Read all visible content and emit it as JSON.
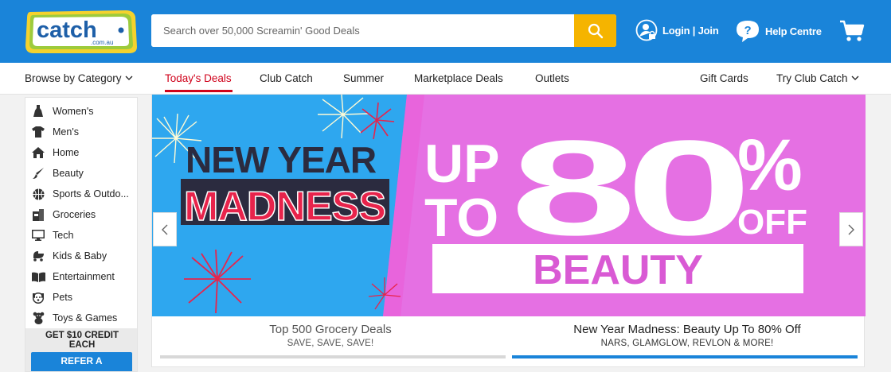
{
  "header": {
    "logo_text": "catch",
    "logo_sub": ".com.au",
    "search_placeholder": "Search over 50,000 Screamin' Good Deals",
    "login_label": "Login | Join",
    "help_label": "Help Centre",
    "colors": {
      "brand_blue": "#1a84d9",
      "search_button": "#f5b400",
      "active_red": "#d0021b"
    }
  },
  "nav": {
    "browse_label": "Browse by Category",
    "items": [
      "Today's Deals",
      "Club Catch",
      "Summer",
      "Marketplace Deals",
      "Outlets"
    ],
    "active_item": "Today's Deals",
    "gift_cards": "Gift Cards",
    "try_club": "Try Club Catch"
  },
  "sidebar": {
    "categories": [
      {
        "label": "Women's",
        "icon": "dress-icon"
      },
      {
        "label": "Men's",
        "icon": "shirt-icon"
      },
      {
        "label": "Home",
        "icon": "home-icon"
      },
      {
        "label": "Beauty",
        "icon": "brush-icon"
      },
      {
        "label": "Sports & Outdo...",
        "icon": "ball-icon"
      },
      {
        "label": "Groceries",
        "icon": "grocery-icon"
      },
      {
        "label": "Tech",
        "icon": "monitor-icon"
      },
      {
        "label": "Kids & Baby",
        "icon": "pram-icon"
      },
      {
        "label": "Entertainment",
        "icon": "book-icon"
      },
      {
        "label": "Pets",
        "icon": "dog-icon"
      },
      {
        "label": "Toys & Games",
        "icon": "teddy-icon"
      }
    ],
    "credit_text": "GET $10 CREDIT EACH",
    "refer_label": "REFER A"
  },
  "banner": {
    "headline_1": "NEW YEAR",
    "headline_2": "MADNESS",
    "offer_1": "UP",
    "offer_2": "TO",
    "offer_big": "80%",
    "offer_off": "OFF",
    "offer_category": "BEAUTY"
  },
  "tabs": [
    {
      "title": "Top 500 Grocery Deals",
      "subtitle": "SAVE, SAVE, SAVE!",
      "active": false
    },
    {
      "title": "New Year Madness: Beauty Up To 80% Off",
      "subtitle": "NARS, GLAMGLOW, REVLON & MORE!",
      "active": true
    }
  ]
}
